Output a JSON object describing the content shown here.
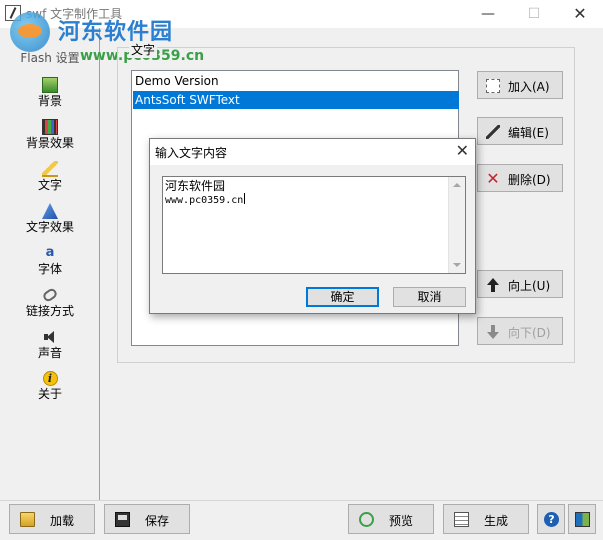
{
  "window": {
    "title": "swf 文字制作工具",
    "min_glyph": "—",
    "max_glyph": "☐",
    "close_glyph": "✕"
  },
  "watermark": {
    "title": "河东软件园",
    "url": "www.pc0359.cn"
  },
  "sidebar": {
    "items": [
      {
        "label": "Flash 设置",
        "icon": "flash-settings-icon"
      },
      {
        "label": "背景",
        "icon": "background-icon"
      },
      {
        "label": "背景效果",
        "icon": "background-effect-icon"
      },
      {
        "label": "文字",
        "icon": "text-icon"
      },
      {
        "label": "文字效果",
        "icon": "text-effect-icon"
      },
      {
        "label": "字体",
        "icon": "font-icon"
      },
      {
        "label": "链接方式",
        "icon": "link-icon"
      },
      {
        "label": "声音",
        "icon": "sound-icon"
      },
      {
        "label": "关于",
        "icon": "about-icon"
      }
    ],
    "font_icon_glyph": "a",
    "about_icon_glyph": "i"
  },
  "main": {
    "group_label": "文字",
    "list": [
      "Demo Version",
      "AntsSoft SWFText"
    ],
    "selected_index": 1,
    "buttons": {
      "add": "加入(A)",
      "edit": "编辑(E)",
      "delete": "删除(D)",
      "up": "向上(U)",
      "down": "向下(D)"
    },
    "delete_glyph": "✕"
  },
  "dialog": {
    "title": "输入文字内容",
    "close_glyph": "✕",
    "text_lines": [
      "河东软件园",
      "www.pc0359.cn"
    ],
    "ok": "确定",
    "cancel": "取消"
  },
  "bottom": {
    "load": "加载",
    "save": "保存",
    "preview": "预览",
    "generate": "生成",
    "help_glyph": "?"
  },
  "colors": {
    "selection": "#0078d7",
    "accent_blue": "#1e5fb4",
    "delete_red": "#c0262d"
  }
}
